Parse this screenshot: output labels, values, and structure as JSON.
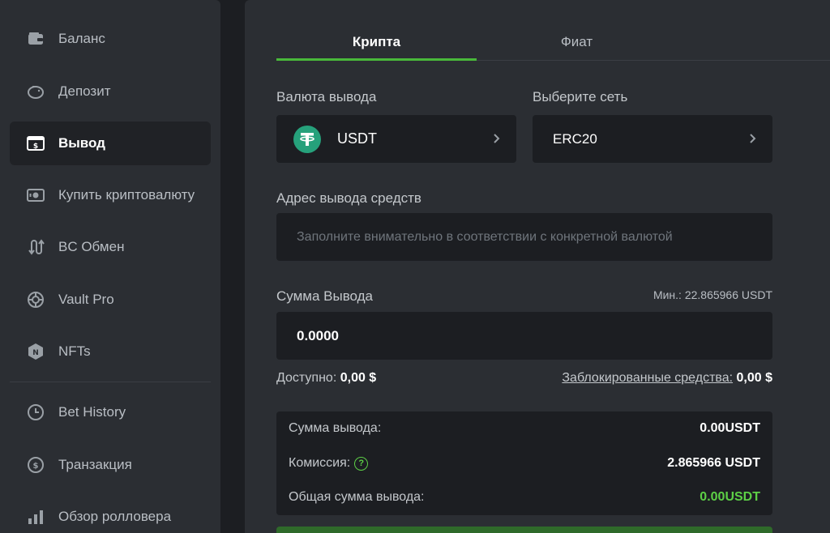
{
  "sidebar": {
    "items": [
      {
        "label": "Баланс",
        "icon": "wallet-icon"
      },
      {
        "label": "Депозит",
        "icon": "piggy-bank-icon"
      },
      {
        "label": "Вывод",
        "icon": "withdraw-icon",
        "active": true
      },
      {
        "label": "Купить криптовалюту",
        "icon": "cash-icon"
      },
      {
        "label": "BC Обмен",
        "icon": "swap-icon"
      },
      {
        "label": "Vault Pro",
        "icon": "vault-icon"
      },
      {
        "label": "NFTs",
        "icon": "nft-icon"
      },
      {
        "label": "Bet History",
        "icon": "clock-icon"
      },
      {
        "label": "Транзакция",
        "icon": "transaction-icon"
      },
      {
        "label": "Обзор ролловера",
        "icon": "bar-chart-icon"
      }
    ]
  },
  "tabs": {
    "crypto": "Крипта",
    "fiat": "Фиат"
  },
  "form": {
    "currency_label": "Валюта вывода",
    "currency_value": "USDT",
    "network_label": "Выберите сеть",
    "network_value": "ERC20",
    "address_label": "Адрес вывода средств",
    "address_placeholder": "Заполните внимательно в соответствии с конкретной валютой",
    "amount_label": "Сумма Вывода",
    "min_text": "Мин.: 22.865966 USDT",
    "amount_value": "0.0000",
    "available_label": "Доступно:",
    "available_value": "0,00 $",
    "locked_label": "Заблокированные средства:",
    "locked_value": "0,00 $"
  },
  "summary": {
    "withdraw_label": "Сумма вывода:",
    "withdraw_value": "0.00USDT",
    "fee_label": "Комиссия:",
    "fee_value": "2.865966 USDT",
    "total_label": "Общая сумма вывода:",
    "total_value": "0.00USDT"
  },
  "colors": {
    "accent": "#49b93a",
    "total_green": "#5dd046",
    "tether": "#26a17b"
  }
}
